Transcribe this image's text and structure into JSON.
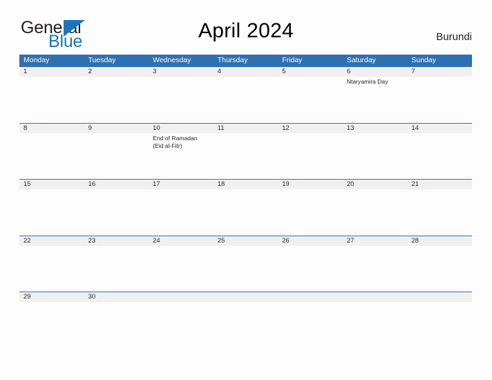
{
  "header": {
    "logo": {
      "text_primary": "General",
      "text_secondary": "Blue",
      "mark_icon": "triangle-logo-icon",
      "primary_color": "#231f20",
      "secondary_color": "#1c75bc"
    },
    "title": "April 2024",
    "country": "Burundi"
  },
  "calendar": {
    "accent_color": "#2e71b0",
    "band_color": "#f0f0f0",
    "weekdays": [
      "Monday",
      "Tuesday",
      "Wednesday",
      "Thursday",
      "Friday",
      "Saturday",
      "Sunday"
    ],
    "weeks": [
      {
        "days": [
          {
            "number": "1",
            "events": []
          },
          {
            "number": "2",
            "events": []
          },
          {
            "number": "3",
            "events": []
          },
          {
            "number": "4",
            "events": []
          },
          {
            "number": "5",
            "events": []
          },
          {
            "number": "6",
            "events": [
              "Ntaryamira Day"
            ]
          },
          {
            "number": "7",
            "events": []
          }
        ]
      },
      {
        "days": [
          {
            "number": "8",
            "events": []
          },
          {
            "number": "9",
            "events": []
          },
          {
            "number": "10",
            "events": [
              "End of Ramadan",
              "(Eid al-Fitr)"
            ]
          },
          {
            "number": "11",
            "events": []
          },
          {
            "number": "12",
            "events": []
          },
          {
            "number": "13",
            "events": []
          },
          {
            "number": "14",
            "events": []
          }
        ]
      },
      {
        "days": [
          {
            "number": "15",
            "events": []
          },
          {
            "number": "16",
            "events": []
          },
          {
            "number": "17",
            "events": []
          },
          {
            "number": "18",
            "events": []
          },
          {
            "number": "19",
            "events": []
          },
          {
            "number": "20",
            "events": []
          },
          {
            "number": "21",
            "events": []
          }
        ]
      },
      {
        "days": [
          {
            "number": "22",
            "events": []
          },
          {
            "number": "23",
            "events": []
          },
          {
            "number": "24",
            "events": []
          },
          {
            "number": "25",
            "events": []
          },
          {
            "number": "26",
            "events": []
          },
          {
            "number": "27",
            "events": []
          },
          {
            "number": "28",
            "events": []
          }
        ]
      },
      {
        "days": [
          {
            "number": "29",
            "events": []
          },
          {
            "number": "30",
            "events": []
          },
          {
            "number": "",
            "events": []
          },
          {
            "number": "",
            "events": []
          },
          {
            "number": "",
            "events": []
          },
          {
            "number": "",
            "events": []
          },
          {
            "number": "",
            "events": []
          }
        ]
      }
    ]
  }
}
